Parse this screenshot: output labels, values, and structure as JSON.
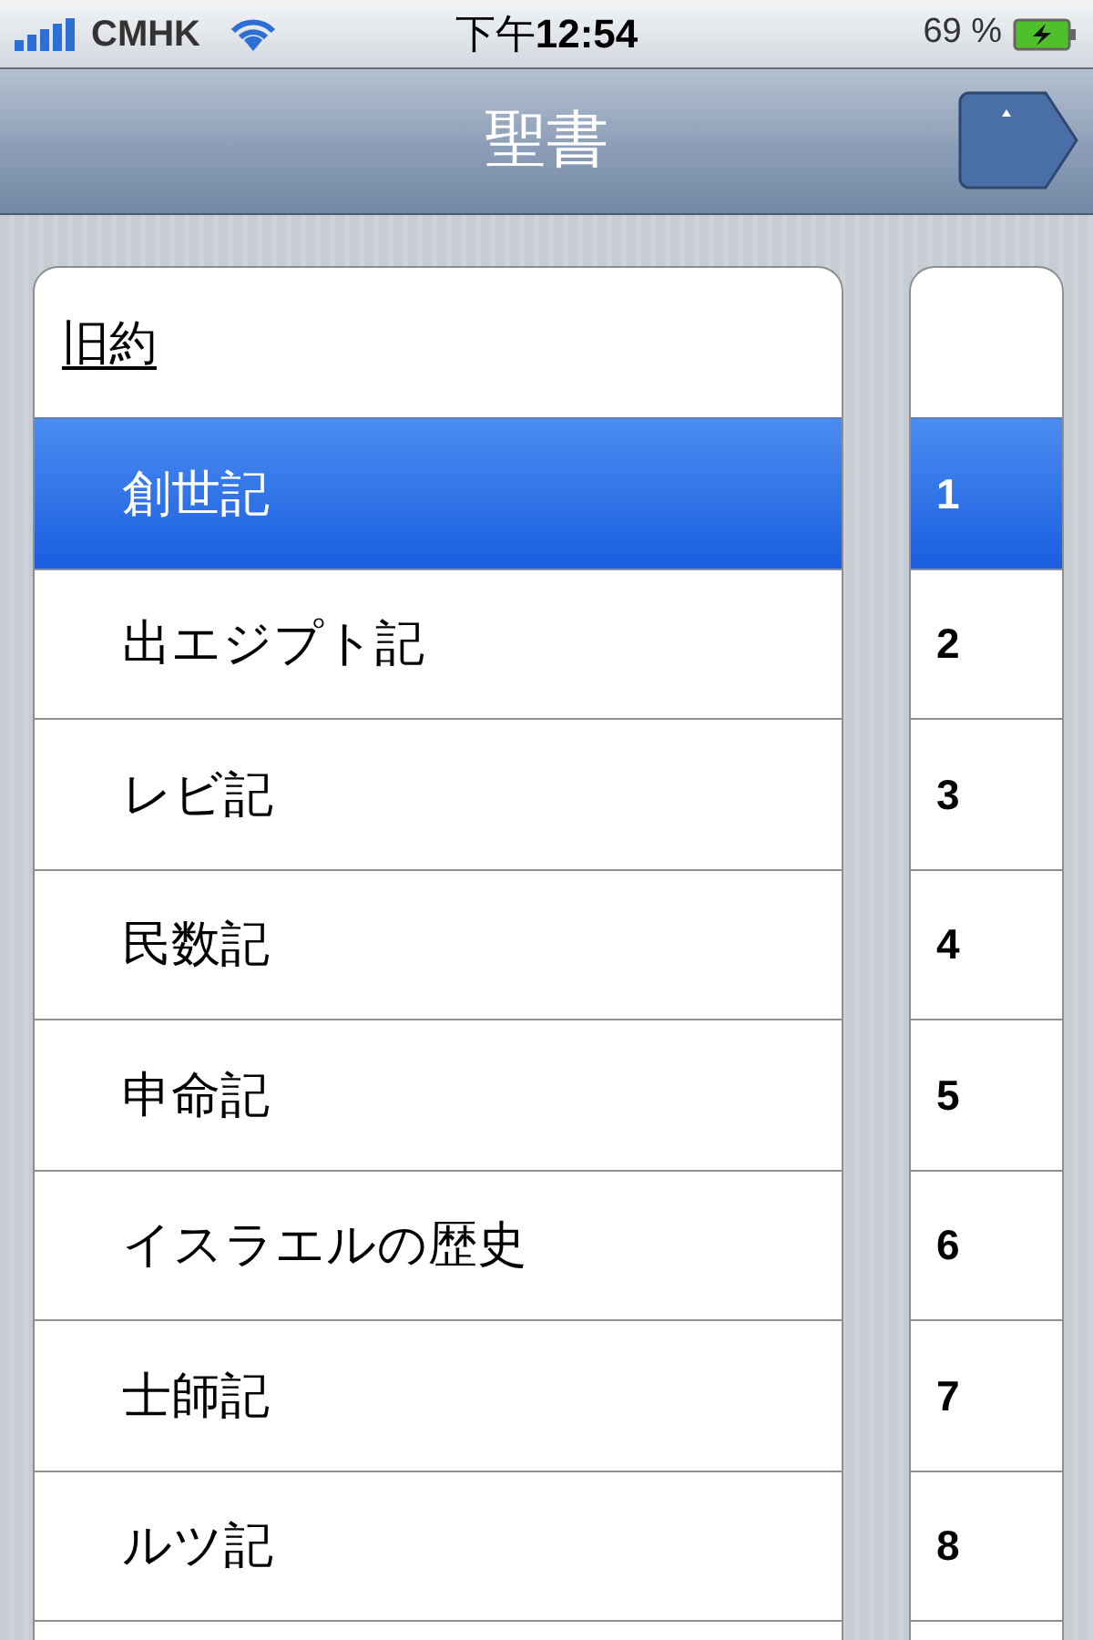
{
  "status_bar": {
    "carrier": "CMHK",
    "time": "下午**12:54**",
    "battery": "69 %"
  },
  "nav_bar": {
    "title": "聖書"
  },
  "section": {
    "title": "旧約"
  },
  "books": [
    {
      "name": "創世記",
      "selected": true
    },
    {
      "name": "出エジプト記",
      "selected": false
    },
    {
      "name": "レビ記",
      "selected": false
    },
    {
      "name": "民数記",
      "selected": false
    },
    {
      "name": "申命記",
      "selected": false
    },
    {
      "name": "イスラエルの歴史",
      "selected": false
    },
    {
      "name": "士師記",
      "selected": false
    },
    {
      "name": "ルツ記",
      "selected": false
    }
  ],
  "chapters": [
    {
      "number": "1",
      "selected": true
    },
    {
      "number": "2",
      "selected": false
    },
    {
      "number": "3",
      "selected": false
    },
    {
      "number": "4",
      "selected": false
    },
    {
      "number": "5",
      "selected": false
    },
    {
      "number": "6",
      "selected": false
    },
    {
      "number": "7",
      "selected": false
    },
    {
      "number": "8",
      "selected": false
    }
  ]
}
